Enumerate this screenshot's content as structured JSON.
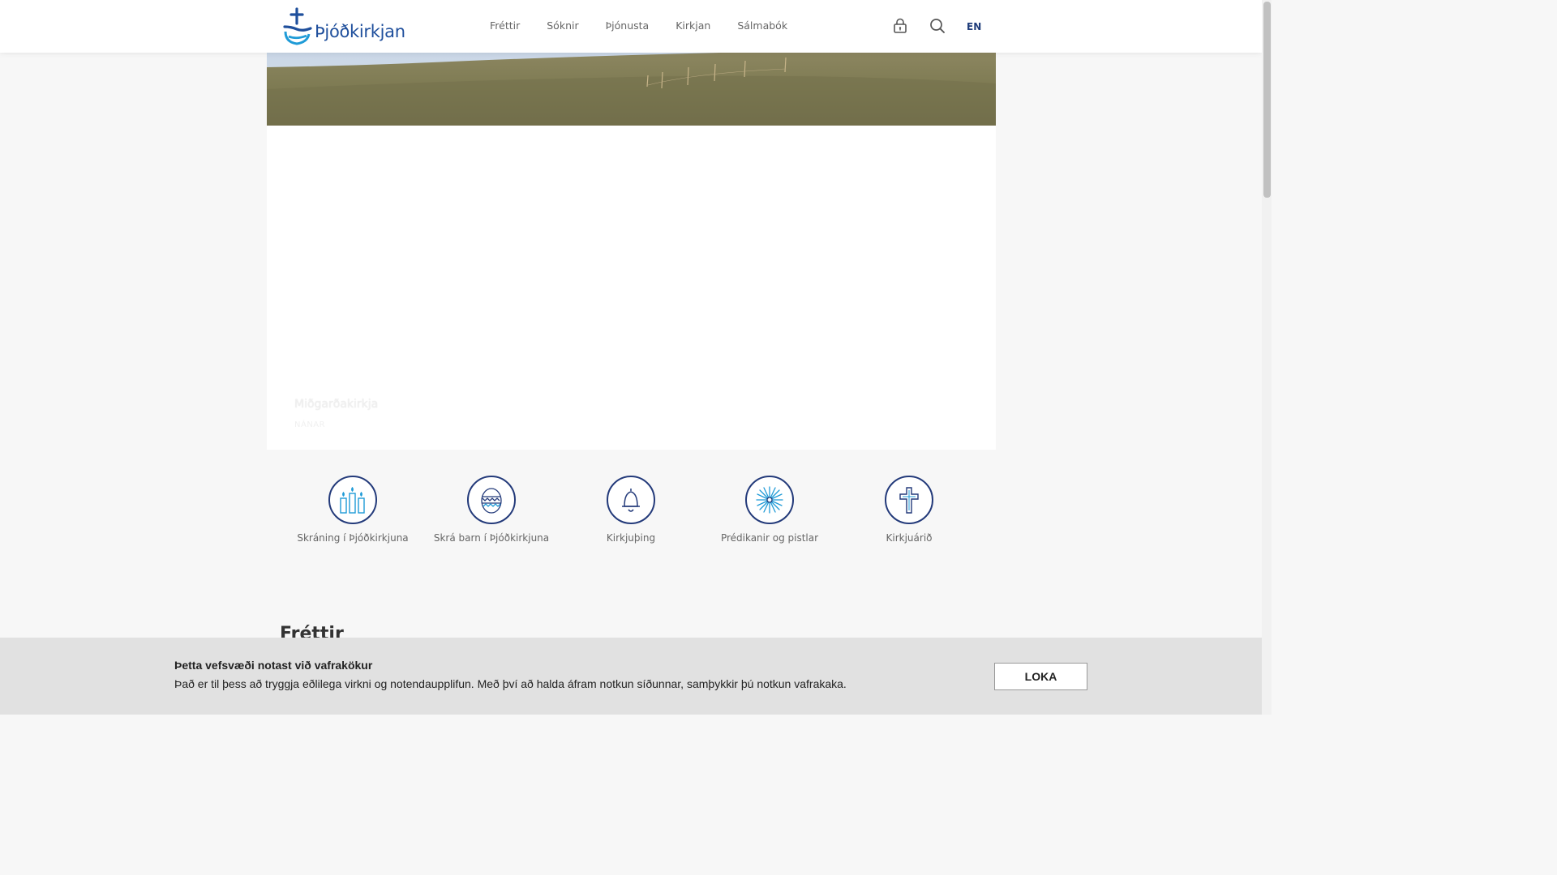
{
  "header": {
    "logo_text": "Þjóðkirkjan",
    "nav": [
      "Fréttir",
      "Sóknir",
      "Þjónusta",
      "Kirkjan",
      "Sálmabók"
    ],
    "lock_icon": "lock-icon",
    "search_icon": "search-icon",
    "lang": "EN"
  },
  "hero": {
    "title": "Miðgarðakirkja",
    "link": "NÁNAR"
  },
  "quick_links": [
    {
      "label": "Skráning í Þjóðkirkjuna",
      "icon": "candles-icon"
    },
    {
      "label": "Skrá barn í Þjóðkirkjuna",
      "icon": "egg-icon"
    },
    {
      "label": "Kirkjuþing",
      "icon": "bell-icon"
    },
    {
      "label": "Prédikanir og pistlar",
      "icon": "star-icon"
    },
    {
      "label": "Kirkjuárið",
      "icon": "cross-icon"
    }
  ],
  "news": {
    "title": "Fréttir"
  },
  "cookie": {
    "title": "Þetta vefsvæði notast við vafrakökur",
    "text": "Það er til þess að tryggja eðlilega virkni og notendaupplifun. Með því að halda áfram notkun síðunnar, samþykkir þú notkun vafrakaka.",
    "button": "LOKA"
  },
  "colors": {
    "brand": "#1f4f9c",
    "icon_stroke": "#233a7a",
    "accent": "#1f9bd7"
  }
}
